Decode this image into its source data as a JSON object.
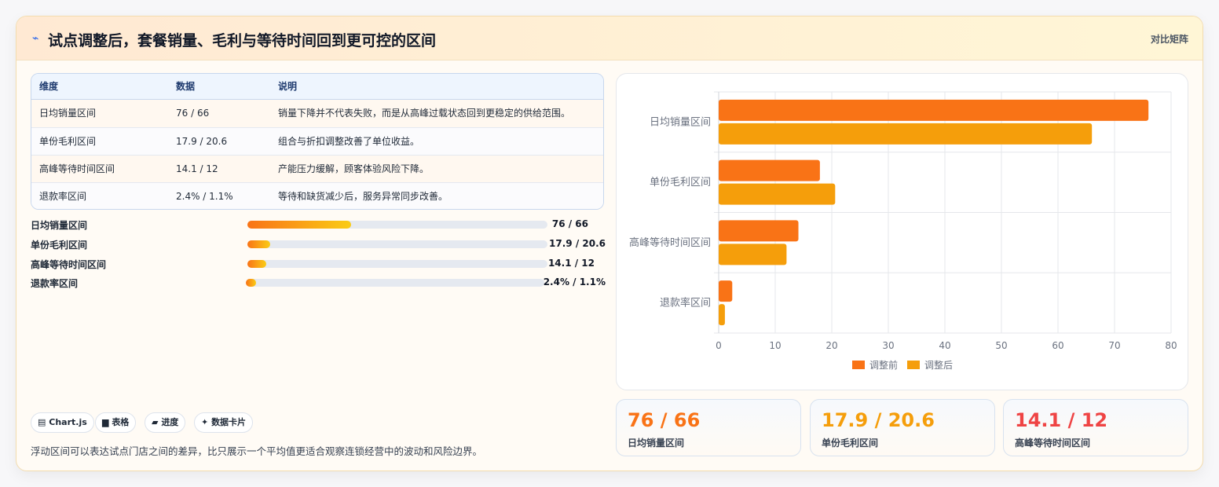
{
  "header": {
    "title": "试点调整后，套餐销量、毛利与等待时间回到更可控的区间",
    "title_icon": "⌁",
    "tag": "对比矩阵"
  },
  "table": {
    "columns": [
      "维度",
      "数据",
      "说明"
    ],
    "rows": [
      {
        "dim": "日均销量区间",
        "data": "76 / 66",
        "note": "销量下降并不代表失败，而是从高峰过载状态回到更稳定的供给范围。"
      },
      {
        "dim": "单份毛利区间",
        "data": "17.9 / 20.6",
        "note": "组合与折扣调整改善了单位收益。"
      },
      {
        "dim": "高峰等待时间区间",
        "data": "14.1 / 12",
        "note": "产能压力缓解，顾客体验风险下降。"
      },
      {
        "dim": "退款率区间",
        "data": "2.4% / 1.1%",
        "note": "等待和缺货减少后，服务异常同步改善。"
      }
    ]
  },
  "progress": [
    {
      "label": "日均销量区间",
      "value_text": "76 / 66",
      "fraction": 0.345
    },
    {
      "label": "单份毛利区间",
      "value_text": "17.9 / 20.6",
      "fraction": 0.075
    },
    {
      "label": "高峰等待时间区间",
      "value_text": "14.1 / 12",
      "fraction": 0.062
    },
    {
      "label": "退款率区间",
      "value_text": "2.4% / 1.1%",
      "fraction": 0.035
    }
  ],
  "pills": [
    {
      "icon": "▤",
      "label": "Chart.js",
      "icon_name": "chart-icon"
    },
    {
      "icon": "▆",
      "label": "表格",
      "icon_name": "table-icon"
    },
    {
      "icon": "▰",
      "label": "进度",
      "icon_name": "progress-icon"
    },
    {
      "icon": "✦",
      "label": "数据卡片",
      "icon_name": "sparkle-icon"
    }
  ],
  "footnote": "浮动区间可以表达试点门店之间的差异，比只展示一个平均值更适合观察连锁经营中的波动和风险边界。",
  "chart_data": {
    "type": "bar",
    "orientation": "horizontal",
    "categories": [
      "日均销量区间",
      "单份毛利区间",
      "高峰等待时间区间",
      "退款率区间"
    ],
    "series": [
      {
        "name": "调整前",
        "values": [
          76,
          17.9,
          14.1,
          2.4
        ],
        "color": "#f97316"
      },
      {
        "name": "调整后",
        "values": [
          66,
          20.6,
          12,
          1.1
        ],
        "color": "#f59e0b"
      }
    ],
    "xlim": [
      0,
      80
    ],
    "xticks": [
      0,
      10,
      20,
      30,
      40,
      50,
      60,
      70,
      80
    ],
    "grid": true,
    "legend": "bottom"
  },
  "kpis": [
    {
      "value": "76 / 66",
      "label": "日均销量区间",
      "color": "#f97316"
    },
    {
      "value": "17.9 / 20.6",
      "label": "单份毛利区间",
      "color": "#f59e0b"
    },
    {
      "value": "14.1 / 12",
      "label": "高峰等待时间区间",
      "color": "#ef4444"
    }
  ]
}
